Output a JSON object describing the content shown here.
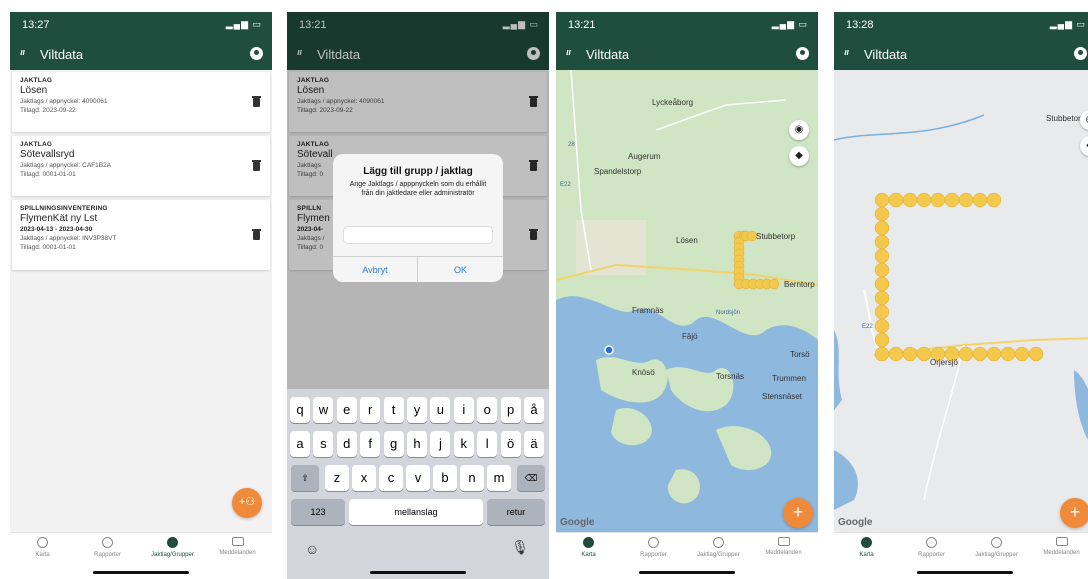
{
  "app": {
    "title": "Viltdata"
  },
  "colors": {
    "primary": "#1f4d3e",
    "accent": "#ef8a3a",
    "track": "#f2c94c",
    "water": "#8fb8de",
    "land": "#cfe5c3"
  },
  "screens": [
    {
      "status_time": "13:27",
      "cards": [
        {
          "category": "JAKTLAG",
          "name": "Lösen",
          "key": "Jaktlags / appnyckel: 4090061",
          "added": "Tillagd: 2023-09-22"
        },
        {
          "category": "JAKTLAG",
          "name": "Sötevallsryd",
          "key": "Jaktlags / appnyckel: CAF1B2A",
          "added": "Tillagd: 0001-01-01"
        },
        {
          "category": "SPILLNINGSINVENTERING",
          "name": "FlymenKät ny Lst",
          "dates": "2023-04-13 - 2023-04-30",
          "key": "Jaktlags / appnyckel: INV3P38VT",
          "added": "Tillagd: 0001-01-01"
        }
      ],
      "fab_icon": "add-group-icon"
    },
    {
      "status_time": "13:21",
      "cards": [
        {
          "category": "JAKTLAG",
          "name": "Lösen",
          "key": "Jaktlags / appnyckel: 4090061",
          "added": "Tillagd: 2023-09-22"
        },
        {
          "category": "JAKTLAG",
          "name": "Sötevall",
          "key": "Jaktlags",
          "added": "Tillagd: 0"
        },
        {
          "category": "SPILLN",
          "name": "Flymen",
          "dates": "2023-04-",
          "key": "Jaktlags /",
          "added": "Tillagd: 0"
        }
      ],
      "dialog": {
        "title": "Lägg till grupp / jaktlag",
        "message": "Ange Jaktlags / apppnyckeln som du erhållit från din jaktledare eller administratör",
        "cancel": "Avbryt",
        "ok": "OK"
      },
      "keyboard": {
        "row1": [
          "q",
          "w",
          "e",
          "r",
          "t",
          "y",
          "u",
          "i",
          "o",
          "p",
          "å"
        ],
        "row2": [
          "a",
          "s",
          "d",
          "f",
          "g",
          "h",
          "j",
          "k",
          "l",
          "ö",
          "ä"
        ],
        "row3": [
          "z",
          "x",
          "c",
          "v",
          "b",
          "n",
          "m"
        ],
        "numbers": "123",
        "space": "mellanslag",
        "return": "retur"
      }
    },
    {
      "status_time": "13:21",
      "map_labels": [
        "Lyckeåborg",
        "Augerum",
        "Spandelstorp",
        "Lösen",
        "Stubbetorp",
        "Berntorp",
        "Framnäs",
        "Fäjö",
        "Knösö",
        "Torsnäs",
        "Trummen",
        "Stensnäset",
        "Torsö"
      ],
      "small_labels": [
        "28",
        "E22",
        "Nordsjön"
      ]
    },
    {
      "status_time": "13:28",
      "map_labels": [
        "Stubbetorp",
        "Orjersjö"
      ],
      "small_labels": [
        "E22"
      ]
    }
  ],
  "tabs": [
    {
      "label": "Karta",
      "icon": "globe-icon"
    },
    {
      "label": "Rapporter",
      "icon": "history-icon"
    },
    {
      "label": "Jaktlag/Grupper",
      "icon": "group-icon"
    },
    {
      "label": "Meddelanden",
      "icon": "mail-icon"
    }
  ],
  "google_label": "Google"
}
